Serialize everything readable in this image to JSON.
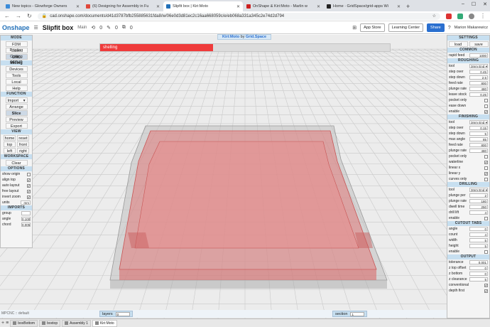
{
  "browser": {
    "tabs": [
      {
        "title": "New topics - Glowforge Owners",
        "color": "#3b8bd9",
        "active": false
      },
      {
        "title": "(6) Designing for Assembly in Fu",
        "color": "#e0483b",
        "active": false
      },
      {
        "title": "Slipfit box | Kiri:Moto",
        "color": "#2270b8",
        "active": true
      },
      {
        "title": "OnShape & Kiri:Moto - Marlin w",
        "color": "#cc2020",
        "active": false
      },
      {
        "title": "Home · GridSpace/grid-apps Wi",
        "color": "#222222",
        "active": false
      }
    ],
    "new_tab": "+",
    "url": "cad.onshape.com/documents/d41d3787bfb255885631fda8/w/06e0d3d81ec2c16aa668059c/e/eb068a331a345c2e74d2d794"
  },
  "onshape": {
    "logo": "Onshape",
    "doc_title": "Slipfit box",
    "branch": "Main",
    "counts": [
      "0",
      "0",
      "0"
    ],
    "app_store": "App Store",
    "learning_center": "Learning Center",
    "share": "Share",
    "user": "Marion Makarewicz"
  },
  "kiri": {
    "title": "Kiri:Moto",
    "by": "by",
    "brand": "Grid.Space",
    "progress_label": "shelling",
    "progress": 0.39
  },
  "left_panel": {
    "mode_head": "MODE",
    "modes": [
      "FDM Printing",
      "Laser Cutting",
      "CNC Milling"
    ],
    "setup_head": "SETUP",
    "setup": [
      "Devices",
      "Tools",
      "Local",
      "Help"
    ],
    "function_head": "FUNCTION",
    "import": "Import",
    "functions": [
      "Arrange",
      "Slice",
      "Preview",
      "Export"
    ],
    "view_head": "VIEW",
    "view_rows": [
      [
        "home",
        "reset"
      ],
      [
        "top",
        "front"
      ],
      [
        "left",
        "right"
      ]
    ],
    "workspace_head": "WORKSPACE",
    "clear": "Clear",
    "options_head": "OPTIONS",
    "options": [
      {
        "label": "show origin",
        "checked": false
      },
      {
        "label": "align top",
        "checked": true
      },
      {
        "label": "auto layout",
        "checked": true
      },
      {
        "label": "free layout",
        "checked": true
      },
      {
        "label": "invert zoom",
        "checked": true
      }
    ],
    "units_label": "units",
    "units_value": "mm",
    "imports_head": "IMPORTS",
    "imports": [
      {
        "label": "group",
        "value": ""
      },
      {
        "label": "angle",
        "value": "0.100"
      },
      {
        "label": "chord",
        "value": "0.005"
      }
    ]
  },
  "right_panel": {
    "settings_head": "SETTINGS",
    "load": "load",
    "save": "save",
    "common_head": "COMMON",
    "rapid_feed": {
      "label": "rapid feed",
      "value": "1000"
    },
    "roughing_head": "ROUGHING",
    "roughing_tool": {
      "label": "tool",
      "value": "3mm End"
    },
    "roughing": [
      {
        "label": "step over",
        "value": "0.45"
      },
      {
        "label": "step down",
        "value": "2.5"
      },
      {
        "label": "feed rate",
        "value": "800"
      },
      {
        "label": "plunge rate",
        "value": "480"
      },
      {
        "label": "leave stock",
        "value": "0.25"
      }
    ],
    "roughing_checks": [
      {
        "label": "pocket only",
        "checked": false
      },
      {
        "label": "ease down",
        "checked": false
      },
      {
        "label": "enable",
        "checked": true
      }
    ],
    "finishing_head": "FINISHING",
    "finishing_tool": {
      "label": "tool",
      "value": "3mm End"
    },
    "finishing": [
      {
        "label": "step over",
        "value": "0.15"
      },
      {
        "label": "step down",
        "value": "5"
      },
      {
        "label": "max angle",
        "value": "85"
      },
      {
        "label": "feed rate",
        "value": "800"
      },
      {
        "label": "plunge rate",
        "value": "480"
      }
    ],
    "finishing_checks": [
      {
        "label": "pocket only",
        "checked": false
      },
      {
        "label": "waterline",
        "checked": true
      },
      {
        "label": "linear x",
        "checked": false
      },
      {
        "label": "linear y",
        "checked": true
      },
      {
        "label": "curves only",
        "checked": false
      }
    ],
    "drilling_head": "DRILLING",
    "drilling_tool": {
      "label": "tool",
      "value": "3mm End"
    },
    "drilling": [
      {
        "label": "plunge per",
        "value": "2"
      },
      {
        "label": "plunge rate",
        "value": "180"
      },
      {
        "label": "dwell time",
        "value": "250"
      },
      {
        "label": "drill lift",
        "value": "4"
      }
    ],
    "drilling_checks": [
      {
        "label": "enable",
        "checked": false
      }
    ],
    "cutout_head": "CUTOUT TABS",
    "cutout": [
      {
        "label": "angle",
        "value": "0"
      },
      {
        "label": "count",
        "value": "4"
      },
      {
        "label": "width",
        "value": "5"
      },
      {
        "label": "height",
        "value": "5"
      }
    ],
    "cutout_checks": [
      {
        "label": "enable",
        "checked": false
      }
    ],
    "output_head": "OUTPUT",
    "output": [
      {
        "label": "tolerance",
        "value": "0.001"
      },
      {
        "label": "z top offset",
        "value": "0"
      },
      {
        "label": "z bottom",
        "value": "0"
      },
      {
        "label": "z clearance",
        "value": "5"
      }
    ],
    "output_checks": [
      {
        "label": "conventional",
        "checked": true
      },
      {
        "label": "depth first",
        "checked": true
      }
    ]
  },
  "status": {
    "mode": "MPCNC :: default",
    "layers_label": "layers",
    "layers_value": "0",
    "section_label": "section",
    "section_value": "1"
  },
  "os_tabs": [
    {
      "label": "boxBottom",
      "active": false
    },
    {
      "label": "boxtop",
      "active": false
    },
    {
      "label": "Assembly 1",
      "active": false
    },
    {
      "label": "Kiri:Moto",
      "active": true
    }
  ],
  "colors": {
    "accent": "#2270b8",
    "progress": "#ef3b3b",
    "panel_head": "#c7dff0",
    "model_fill": "#e07878",
    "stock_fill": "#b8b8b8"
  }
}
